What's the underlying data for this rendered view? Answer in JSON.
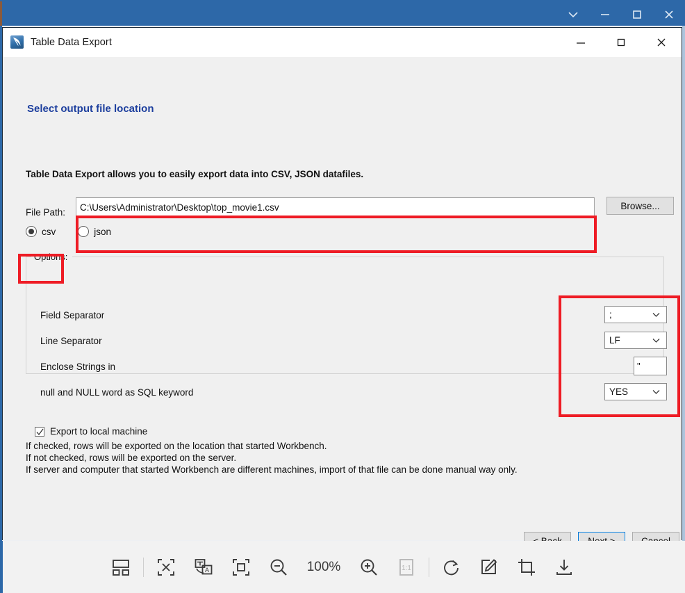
{
  "outer_window": {
    "title": "",
    "controls": [
      {
        "name": "chevron-down-icon",
        "label": "⌄"
      },
      {
        "name": "minimize-icon",
        "label": "—"
      },
      {
        "name": "maximize-icon",
        "label": "□"
      },
      {
        "name": "close-icon",
        "label": "✕"
      }
    ]
  },
  "dialog": {
    "title": "Table Data Export",
    "icon": "workbench-dolphin-icon",
    "controls": [
      {
        "name": "minimize-icon",
        "label": "—"
      },
      {
        "name": "maximize-icon",
        "label": "□"
      },
      {
        "name": "close-icon",
        "label": "✕"
      }
    ],
    "heading": "Select output file location",
    "intro": "Table Data Export allows you to easily export data into CSV, JSON datafiles.",
    "file_path": {
      "label": "File Path:",
      "value": "C:\\Users\\Administrator\\Desktop\\top_movie1.csv",
      "placeholder": "",
      "browse_label": "Browse..."
    },
    "format": {
      "selected": "csv",
      "options": [
        {
          "id": "csv",
          "label": "csv",
          "checked": true
        },
        {
          "id": "json",
          "label": "json",
          "checked": false
        }
      ]
    },
    "options": {
      "legend": "Options:",
      "rows": [
        {
          "label": "Field Separator",
          "control": "combo",
          "value": ";"
        },
        {
          "label": "Line Separator",
          "control": "combo",
          "value": "LF"
        },
        {
          "label": "Enclose Strings in",
          "control": "text",
          "value": "\""
        },
        {
          "label": "null and NULL word as SQL keyword",
          "control": "combo",
          "value": "YES"
        }
      ]
    },
    "export_local": {
      "label": "Export to local machine",
      "checked": true
    },
    "notes": [
      "If checked, rows will be exported on the location that started Workbench.",
      "If not checked, rows will be exported on the server.",
      "If server and computer that started Workbench are different machines, import of that file can be done manual way only."
    ],
    "footer": {
      "back": "< Back",
      "next": "Next >",
      "cancel": "Cancel"
    }
  },
  "annotations": {
    "color": "#ee1c25",
    "boxes": [
      "file-path-field",
      "csv-radio",
      "options-controls"
    ]
  },
  "bottom_toolbar": {
    "zoom_level": "100%",
    "items": [
      {
        "name": "layout-grid-icon"
      },
      {
        "name": "ocr-text-icon"
      },
      {
        "name": "translate-icon"
      },
      {
        "name": "fit-to-frame-icon"
      },
      {
        "name": "zoom-out-icon"
      },
      {
        "name": "zoom-level-label"
      },
      {
        "name": "zoom-in-icon"
      },
      {
        "name": "actual-size-icon"
      },
      {
        "name": "rotate-right-icon"
      },
      {
        "name": "annotate-icon"
      },
      {
        "name": "crop-icon"
      },
      {
        "name": "download-icon"
      }
    ]
  }
}
